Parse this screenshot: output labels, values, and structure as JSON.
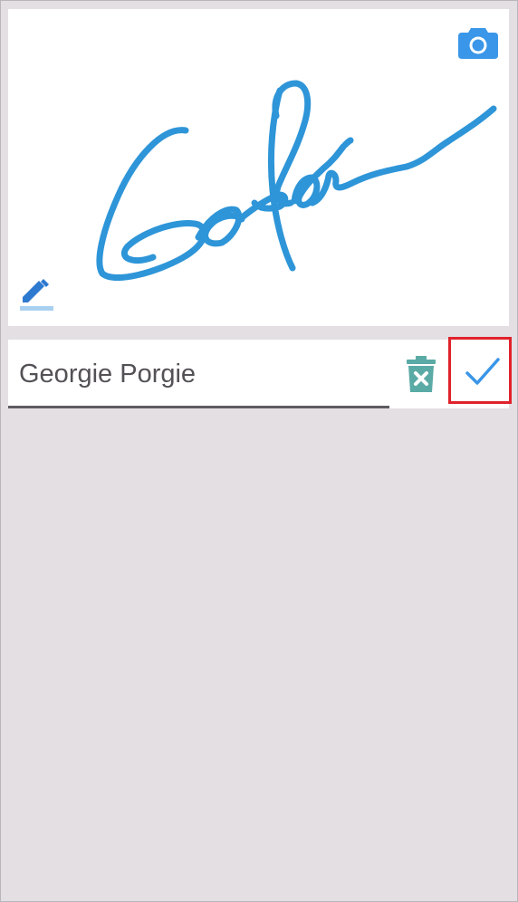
{
  "signature_pad": {
    "camera_icon": "camera-icon",
    "pen_icon": "pen-icon",
    "ink_color": "#2e95d8"
  },
  "name_field": {
    "value": "Georgie Porgie"
  },
  "actions": {
    "delete_icon": "trash-x-icon",
    "confirm_icon": "checkmark-icon",
    "delete_color": "#5aaaa6",
    "confirm_color": "#3a96e8",
    "highlight_color": "#e0222b"
  }
}
